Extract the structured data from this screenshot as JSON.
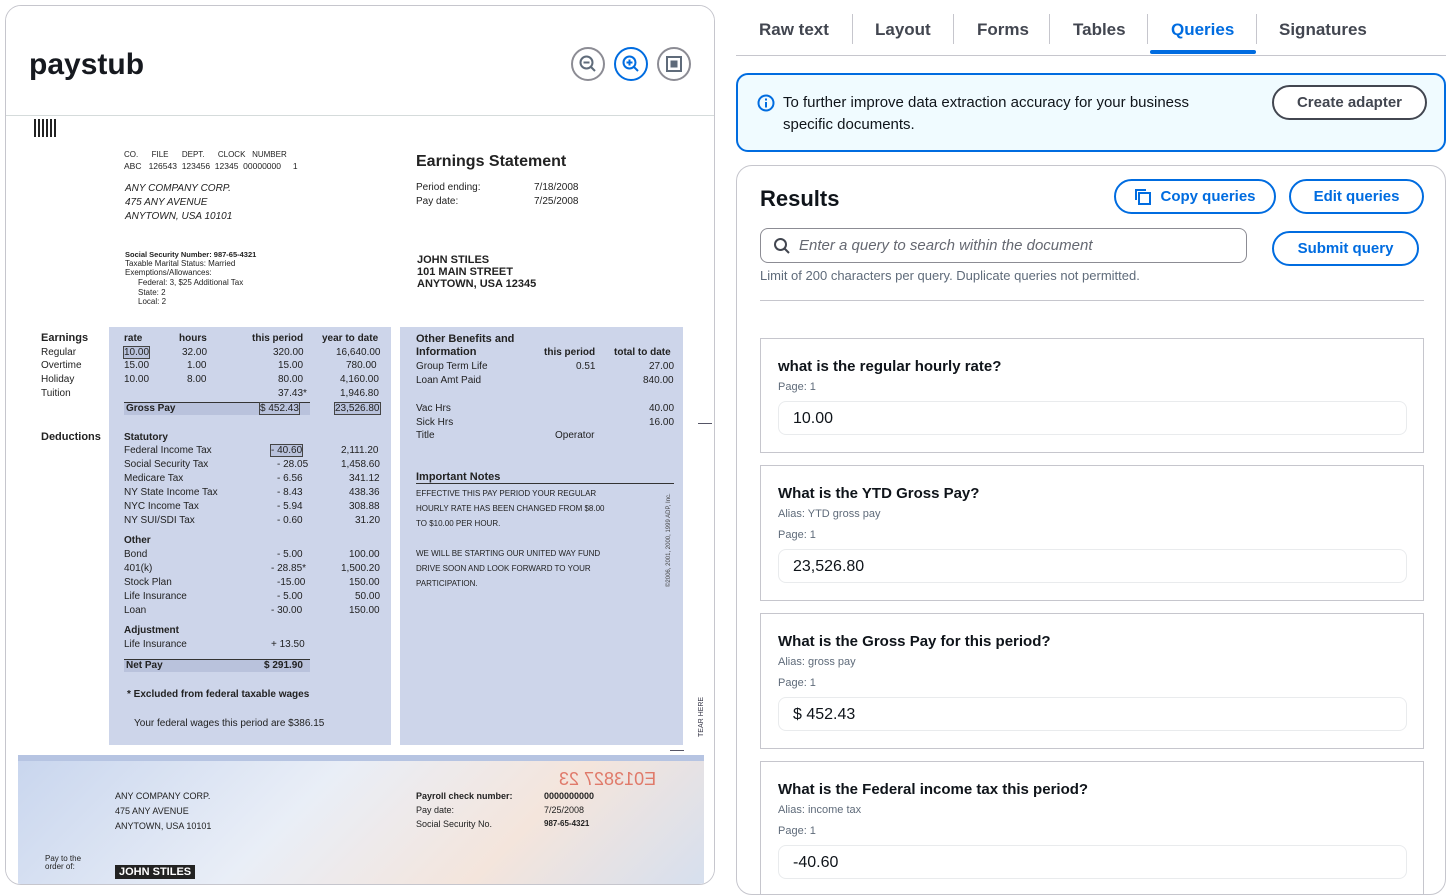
{
  "document": {
    "title": "paystub",
    "zoom_controls": [
      "zoom-out",
      "zoom-in",
      "fit-page"
    ],
    "paystub": {
      "header_codes": {
        "labels": [
          "CO.",
          "FILE",
          "DEPT.",
          "CLOCK",
          "NUMBER"
        ],
        "values": [
          "ABC",
          "126543",
          "123456",
          "12345",
          "00000000",
          "1"
        ]
      },
      "company": [
        "ANY COMPANY CORP.",
        "475 ANY AVENUE",
        "ANYTOWN, USA 10101"
      ],
      "statement_title": "Earnings Statement",
      "period_ending_label": "Period ending:",
      "period_ending": "7/18/2008",
      "pay_date_label": "Pay date:",
      "pay_date": "7/25/2008",
      "ssn_line": "Social Security Number: 987-65-4321",
      "marital_line": "Taxable Marital Status: Married",
      "exemptions_line": "Exemptions/Allowances:",
      "federal_line": "Federal:   3, $25 Additional Tax",
      "state_line": "State:      2",
      "local_line": "Local:      2",
      "employee": [
        "JOHN STILES",
        "101 MAIN STREET",
        "ANYTOWN, USA 12345"
      ],
      "earnings_label": "Earnings",
      "earnings_headers": [
        "rate",
        "hours",
        "this period",
        "year to date"
      ],
      "earnings_rows": [
        [
          "Regular",
          "10.00",
          "32.00",
          "320.00",
          "16,640.00"
        ],
        [
          "Overtime",
          "15.00",
          "1.00",
          "15.00",
          "780.00"
        ],
        [
          "Holiday",
          "10.00",
          "8.00",
          "80.00",
          "4,160.00"
        ],
        [
          "Tuition",
          "",
          "",
          "37.43*",
          "1,946.80"
        ]
      ],
      "gross_pay_label": "Gross Pay",
      "gross_pay": "$ 452.43",
      "gross_ytd": "23,526.80",
      "deductions_label": "Deductions",
      "statutory_label": "Statutory",
      "statutory_rows": [
        [
          "Federal Income Tax",
          "- 40.60",
          "2,111.20"
        ],
        [
          "Social Security Tax",
          "- 28.05",
          "1,458.60"
        ],
        [
          "Medicare Tax",
          "- 6.56",
          "341.12"
        ],
        [
          "NY State Income Tax",
          "- 8.43",
          "438.36"
        ],
        [
          "NYC Income Tax",
          "- 5.94",
          "308.88"
        ],
        [
          "NY SUI/SDI Tax",
          "- 0.60",
          "31.20"
        ]
      ],
      "other_label": "Other",
      "other_rows": [
        [
          "Bond",
          "- 5.00",
          "100.00"
        ],
        [
          "401(k)",
          "- 28.85*",
          "1,500.20"
        ],
        [
          "Stock Plan",
          "-15.00",
          "150.00"
        ],
        [
          "Life Insurance",
          "- 5.00",
          "50.00"
        ],
        [
          "Loan",
          "- 30.00",
          "150.00"
        ]
      ],
      "adjustment_label": "Adjustment",
      "adjustment_row": [
        "Life Insurance",
        "+ 13.50"
      ],
      "net_pay_label": "Net Pay",
      "net_pay": "$ 291.90",
      "excluded_note": "* Excluded from federal taxable wages",
      "federal_wages_note": "Your federal wages this period are $386.15",
      "benefits_title_1": "Other Benefits and",
      "benefits_title_2": "Information",
      "benefits_headers": [
        "this period",
        "total to date"
      ],
      "benefits_rows": [
        [
          "Group Term Life",
          "0.51",
          "27.00"
        ],
        [
          "Loan Amt Paid",
          "",
          "840.00"
        ]
      ],
      "vac_label": "Vac Hrs",
      "vac_value": "40.00",
      "sick_label": "Sick Hrs",
      "sick_value": "16.00",
      "title_label": "Title",
      "title_value": "Operator",
      "notes_title": "Important Notes",
      "notes": [
        "EFFECTIVE THIS PAY PERIOD YOUR REGULAR",
        "HOURLY RATE HAS BEEN CHANGED FROM $8.00",
        "TO $10.00 PER HOUR.",
        "WE WILL BE STARTING OUR UNITED WAY FUND",
        "DRIVE SOON AND LOOK FORWARD TO YOUR",
        "PARTICIPATION."
      ],
      "side_text": "©2006, 2001, 2000, 1999 ADP, Inc.",
      "tear_here": "TEAR HERE",
      "check": {
        "company": [
          "ANY COMPANY CORP.",
          "475 ANY AVENUE",
          "ANYTOWN, USA 10101"
        ],
        "check_number_label": "Payroll check number:",
        "check_number": "0000000000",
        "pay_date_label": "Pay date:",
        "pay_date": "7/25/2008",
        "ssn_label": "Social Security No.",
        "ssn": "987-65-4321",
        "pay_to_label_1": "Pay to the",
        "pay_to_label_2": "order of:",
        "payee": "JOHN STILES",
        "serial": "E013827 23"
      }
    }
  },
  "tabs": [
    "Raw text",
    "Layout",
    "Forms",
    "Tables",
    "Queries",
    "Signatures"
  ],
  "active_tab": "Queries",
  "info": {
    "text": "To further improve data extraction accuracy for your business specific documents.",
    "button": "Create adapter"
  },
  "results": {
    "title": "Results",
    "copy_button": "Copy queries",
    "edit_button": "Edit queries",
    "search_placeholder": "Enter a query to search within the document",
    "submit_button": "Submit query",
    "limit_note": "Limit of 200 characters per query. Duplicate queries not permitted.",
    "queries": [
      {
        "question": "what is the regular hourly rate?",
        "alias": "",
        "page": "Page: 1",
        "answer": "10.00"
      },
      {
        "question": "What is the YTD Gross Pay?",
        "alias": "Alias: YTD gross pay",
        "page": "Page: 1",
        "answer": "23,526.80"
      },
      {
        "question": "What is the Gross Pay for this period?",
        "alias": "Alias: gross pay",
        "page": "Page: 1",
        "answer": "$ 452.43"
      },
      {
        "question": "What is the Federal income tax this period?",
        "alias": "Alias: income tax",
        "page": "Page: 1",
        "answer": "-40.60"
      }
    ]
  },
  "colors": {
    "accent": "#006ce0",
    "doc_shade": "#cdd5ea"
  }
}
